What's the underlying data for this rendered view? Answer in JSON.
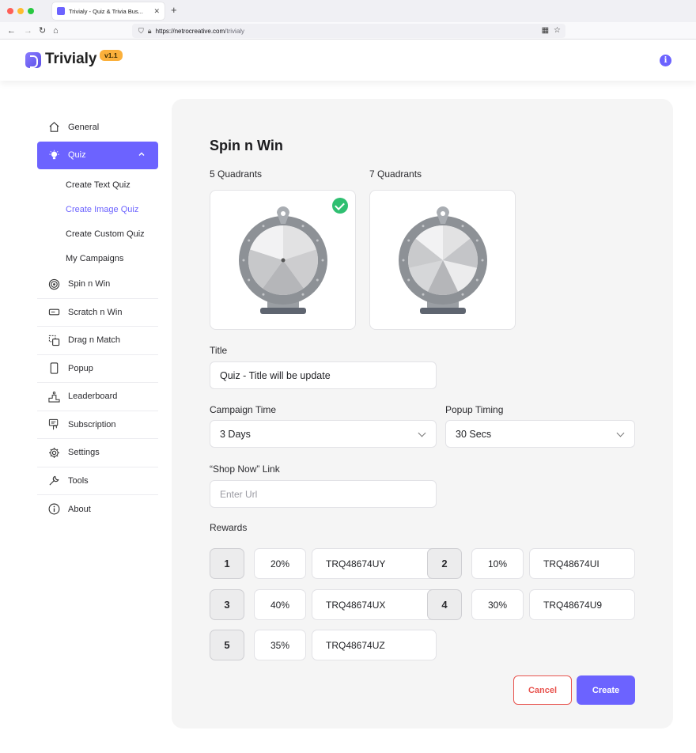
{
  "browser": {
    "tab_title": "Trivialy - Quiz & Trivia Bus...",
    "url_host": "https://netrocreative.com",
    "url_path": "/trivialy"
  },
  "header": {
    "brand": "Trivialy",
    "version": "v1.1"
  },
  "sidebar": {
    "items": [
      {
        "label": "General",
        "icon": "home-icon"
      },
      {
        "label": "Quiz",
        "icon": "lightbulb-icon"
      },
      {
        "label": "Spin n Win",
        "icon": "target-icon"
      },
      {
        "label": "Scratch n Win",
        "icon": "ticket-icon"
      },
      {
        "label": "Drag n Match",
        "icon": "drag-icon"
      },
      {
        "label": "Popup",
        "icon": "phone-icon"
      },
      {
        "label": "Leaderboard",
        "icon": "podium-icon"
      },
      {
        "label": "Subscription",
        "icon": "subscription-icon"
      },
      {
        "label": "Settings",
        "icon": "gear-icon"
      },
      {
        "label": "Tools",
        "icon": "wrench-icon"
      },
      {
        "label": "About",
        "icon": "info-icon"
      }
    ],
    "quiz_sub": [
      {
        "label": "Create Text Quiz"
      },
      {
        "label": "Create Image Quiz"
      },
      {
        "label": "Create Custom Quiz"
      },
      {
        "label": "My Campaigns"
      }
    ]
  },
  "main": {
    "title": "Spin n Win",
    "quad5_label": "5 Quadrants",
    "quad7_label": "7 Quadrants",
    "title_label": "Title",
    "title_value": "Quiz - Title will be update",
    "campaign_time_label": "Campaign Time",
    "campaign_time_value": "3 Days",
    "popup_timing_label": "Popup Timing",
    "popup_timing_value": "30 Secs",
    "shop_link_label": "“Shop Now” Link",
    "shop_link_placeholder": "Enter Url",
    "rewards_label": "Rewards",
    "rewards": [
      {
        "num": "1",
        "pct": "20%",
        "code": "TRQ48674UY"
      },
      {
        "num": "2",
        "pct": "10%",
        "code": "TRQ48674UI"
      },
      {
        "num": "3",
        "pct": "40%",
        "code": "TRQ48674UX"
      },
      {
        "num": "4",
        "pct": "30%",
        "code": "TRQ48674U9"
      },
      {
        "num": "5",
        "pct": "35%",
        "code": "TRQ48674UZ"
      }
    ],
    "cancel_label": "Cancel",
    "create_label": "Create"
  },
  "colors": {
    "accent": "#6c63ff",
    "success": "#2fbf71",
    "danger": "#e8544f",
    "badge": "#fbb03b"
  }
}
